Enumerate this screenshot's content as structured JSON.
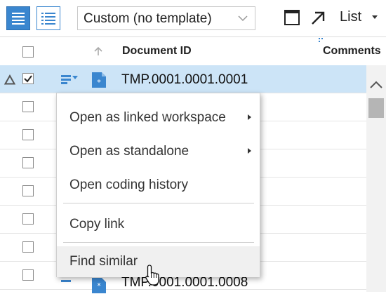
{
  "toolbar": {
    "template_select": {
      "value": "Custom (no template)"
    },
    "list_label": "List",
    "icons": [
      "grid-view-icon",
      "list-view-icon",
      "chevron-down-icon",
      "maximize-icon",
      "expand-arrow-icon",
      "caret-down-icon"
    ]
  },
  "table": {
    "columns": [
      {
        "key": "document_id",
        "label": "Document ID"
      },
      {
        "key": "comments",
        "label": "Comments"
      }
    ],
    "rows": [
      {
        "document_id": "TMP.0001.0001.0001",
        "selected": true,
        "checked": true
      },
      {
        "document_id": "",
        "checked": false
      },
      {
        "document_id": "",
        "checked": false
      },
      {
        "document_id": "",
        "checked": false
      },
      {
        "document_id": "",
        "checked": false
      },
      {
        "document_id": "",
        "checked": false
      },
      {
        "document_id": "",
        "checked": false
      },
      {
        "document_id": "TMP.0001.0001.0008",
        "checked": false
      }
    ]
  },
  "context_menu": {
    "items": [
      {
        "label": "Open as linked workspace",
        "submenu": true
      },
      {
        "label": "Open as standalone",
        "submenu": true
      },
      {
        "label": "Open coding history",
        "submenu": false
      },
      {
        "label": "Copy link",
        "submenu": false
      },
      {
        "label": "Find similar",
        "submenu": false,
        "hovered": true
      }
    ]
  },
  "colors": {
    "accent": "#3a86cf",
    "selected_row": "#cce4f7",
    "menu_hover": "#f0f0f0"
  }
}
